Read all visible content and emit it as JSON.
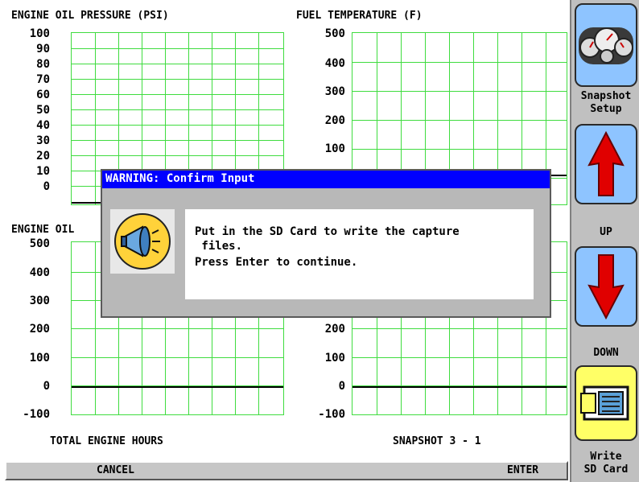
{
  "charts": {
    "oil_pressure": {
      "title": "ENGINE OIL PRESSURE (PSI)",
      "ticks": [
        "100",
        "90",
        "80",
        "70",
        "60",
        "50",
        "40",
        "30",
        "20",
        "10",
        "0"
      ]
    },
    "fuel_temp": {
      "title": "FUEL TEMPERATURE (F)",
      "ticks_top": [
        "500",
        "400",
        "300",
        "200",
        "100"
      ],
      "ticks_bottom": [
        "200",
        "100",
        "0",
        "-100"
      ]
    },
    "oil_temp": {
      "title": "ENGINE OIL",
      "ticks_top": [
        "500"
      ],
      "ticks": [
        "400",
        "300",
        "200",
        "100",
        "0",
        "-100"
      ]
    }
  },
  "footer": {
    "total_hours": "TOTAL ENGINE HOURS",
    "snapshot": "SNAPSHOT 3 - 1"
  },
  "bottom_bar": {
    "cancel": "CANCEL",
    "enter": "ENTER"
  },
  "sidebar": {
    "snapshot_setup": [
      "Snapshot",
      "Setup"
    ],
    "up": "UP",
    "down": "DOWN",
    "write_sd": [
      "Write",
      "SD Card"
    ]
  },
  "dialog": {
    "title": "WARNING: Confirm Input",
    "line1": "Put in the SD Card to write the capture",
    "line2": " files.",
    "line3": "Press Enter to continue."
  },
  "colors": {
    "grid": "#3fdc3f",
    "title_bar": "#0000ff",
    "button_blue": "#7fb8ff",
    "arrow_red": "#e00000",
    "sd_yellow": "#ffff66"
  },
  "icons": {
    "snapshot_setup": "gauges-icon",
    "up": "up-arrow-icon",
    "down": "down-arrow-icon",
    "write_sd": "sd-card-icon",
    "dialog": "megaphone-icon"
  }
}
